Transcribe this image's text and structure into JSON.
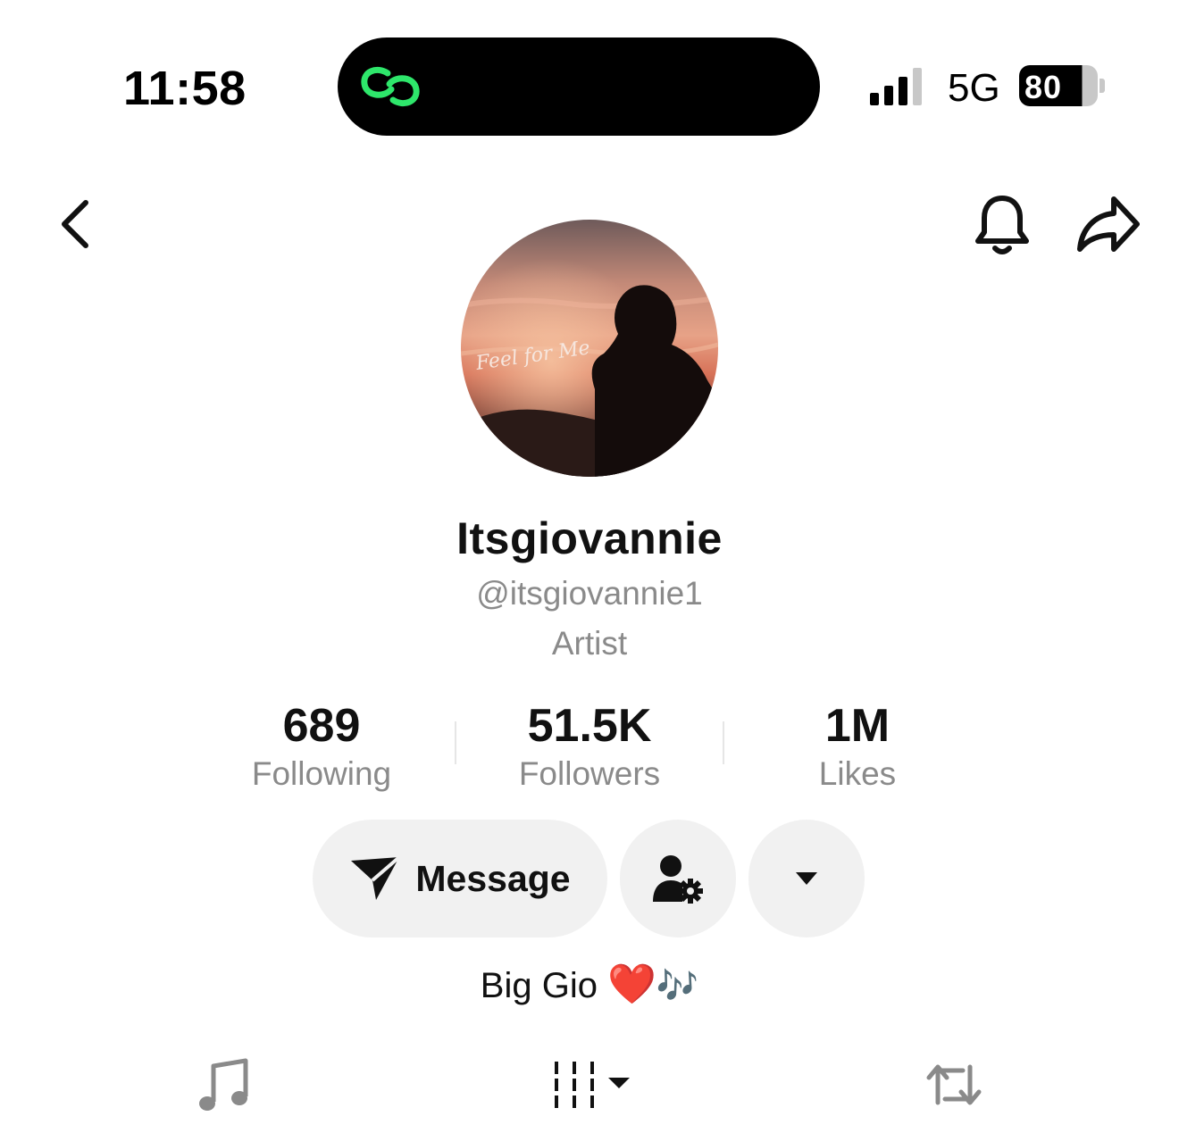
{
  "status_bar": {
    "time": "11:58",
    "network": "5G",
    "battery": "80",
    "island_icon": "link-rings-icon",
    "signal_icon": "signal-bars-icon"
  },
  "nav": {
    "back_icon": "chevron-left-icon",
    "notify_icon": "bell-icon",
    "share_icon": "share-arrow-icon"
  },
  "profile": {
    "avatar_caption": "Feel for Me",
    "display_name": "Itsgiovannie",
    "handle": "@itsgiovannie1",
    "role": "Artist",
    "bio_text": "Big Gio",
    "bio_emoji_heart": "❤️",
    "bio_emoji_notes": "🎶"
  },
  "stats": [
    {
      "value": "689",
      "label": "Following"
    },
    {
      "value": "51.5K",
      "label": "Followers"
    },
    {
      "value": "1M",
      "label": "Likes"
    }
  ],
  "actions": {
    "message_label": "Message",
    "message_icon": "paper-plane-icon",
    "friend_icon": "user-gear-icon",
    "more_icon": "caret-down-icon"
  },
  "tabs": [
    {
      "icon": "music-note-icon"
    },
    {
      "icon": "grid-sort-icon"
    },
    {
      "icon": "repost-icon"
    }
  ],
  "colors": {
    "accent_green": "#2ee66b",
    "secondary_text": "#8a8a8a",
    "button_bg": "#f1f1f1",
    "heart": "#e0162b"
  }
}
